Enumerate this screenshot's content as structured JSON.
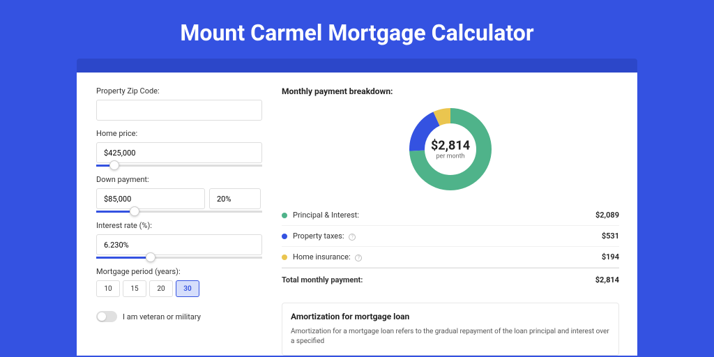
{
  "title": "Mount Carmel Mortgage Calculator",
  "form": {
    "zip": {
      "label": "Property Zip Code:",
      "value": ""
    },
    "price": {
      "label": "Home price:",
      "value": "$425,000",
      "slider_pct": 8
    },
    "down": {
      "label": "Down payment:",
      "amount": "$85,000",
      "pct": "20%",
      "slider_pct": 20
    },
    "rate": {
      "label": "Interest rate (%):",
      "value": "6.230%",
      "slider_pct": 30
    },
    "period": {
      "label": "Mortgage period (years):",
      "options": [
        "10",
        "15",
        "20",
        "30"
      ],
      "selected": "30"
    },
    "veteran": {
      "label": "I am veteran or military",
      "on": false
    }
  },
  "breakdown": {
    "title": "Monthly payment breakdown:",
    "center_amount": "$2,814",
    "center_sub": "per month",
    "rows": {
      "pi": {
        "label": "Principal & Interest:",
        "value": "$2,089"
      },
      "tax": {
        "label": "Property taxes:",
        "value": "$531"
      },
      "ins": {
        "label": "Home insurance:",
        "value": "$194"
      }
    },
    "total": {
      "label": "Total monthly payment:",
      "value": "$2,814"
    }
  },
  "amort": {
    "title": "Amortization for mortgage loan",
    "text": "Amortization for a mortgage loan refers to the gradual repayment of the loan principal and interest over a specified"
  },
  "chart_data": {
    "type": "pie",
    "title": "Monthly payment breakdown",
    "series": [
      {
        "name": "Principal & Interest",
        "value": 2089,
        "color": "#4fb38a"
      },
      {
        "name": "Property taxes",
        "value": 531,
        "color": "#3452e1"
      },
      {
        "name": "Home insurance",
        "value": 194,
        "color": "#eac54f"
      }
    ],
    "total": 2814
  }
}
